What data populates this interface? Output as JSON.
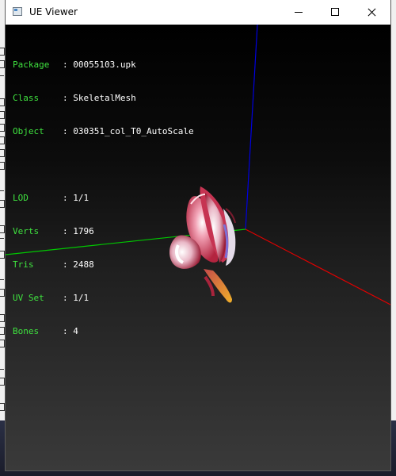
{
  "window": {
    "title": "UE Viewer"
  },
  "info_top": [
    {
      "key": "Package",
      "value": "00055103.upk"
    },
    {
      "key": "Class",
      "value": "SkeletalMesh"
    },
    {
      "key": "Object",
      "value": "030351_col_T0_AutoScale"
    }
  ],
  "info_mesh": [
    {
      "key": "LOD",
      "value": "1/1"
    },
    {
      "key": "Verts",
      "value": "1796"
    },
    {
      "key": "Tris",
      "value": "2488"
    },
    {
      "key": "UV Set",
      "value": "1/1"
    },
    {
      "key": "Bones",
      "value": "4"
    }
  ],
  "axis_colors": {
    "x": "#e00000",
    "y": "#00c800",
    "z": "#0000e0"
  },
  "label_color": "#3fe23f",
  "value_color": "#ffffff"
}
